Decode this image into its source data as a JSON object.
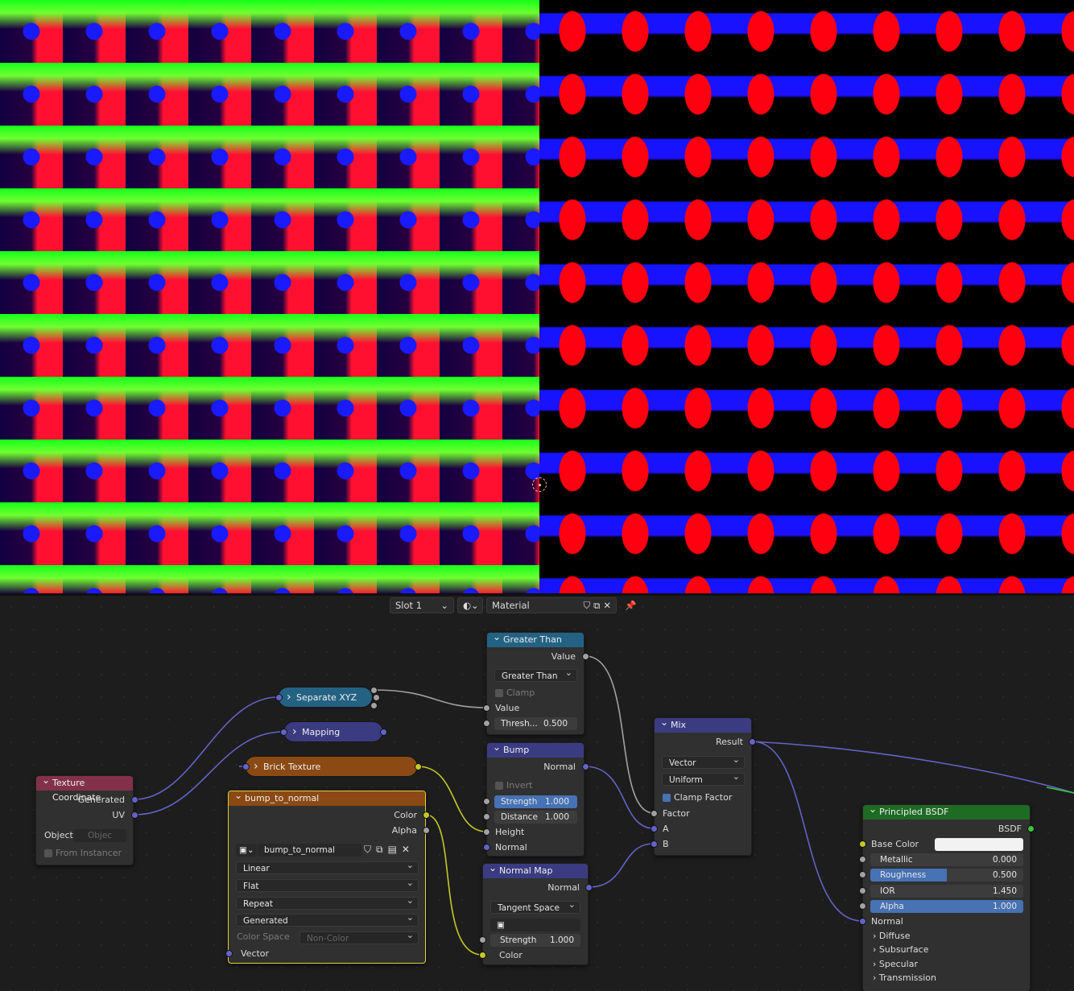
{
  "header": {
    "slot": "Slot 1",
    "material": "Material"
  },
  "nodes": {
    "greater_than": {
      "title": "Greater Than",
      "out_value": "Value",
      "operation": "Greater Than",
      "clamp": "Clamp",
      "in_value": "Value",
      "threshold_label": "Thresh...",
      "threshold": "0.500"
    },
    "separate_xyz": {
      "title": "Separate XYZ"
    },
    "mapping": {
      "title": "Mapping"
    },
    "brick": {
      "title": "Brick Texture"
    },
    "texcoord": {
      "title": "Texture Coordinate",
      "generated": "Generated",
      "uv": "UV",
      "object_label": "Object:",
      "object_placeholder": "Objec",
      "from_instancer": "From Instancer"
    },
    "image": {
      "title": "bump_to_normal",
      "color": "Color",
      "alpha": "Alpha",
      "image_name": "bump_to_normal",
      "interpolation": "Linear",
      "projection": "Flat",
      "extension": "Repeat",
      "source": "Generated",
      "colorspace_label": "Color Space",
      "colorspace": "Non-Color",
      "vector": "Vector"
    },
    "bump": {
      "title": "Bump",
      "normal_out": "Normal",
      "invert": "Invert",
      "strength_label": "Strength",
      "strength": "1.000",
      "distance_label": "Distance",
      "distance": "1.000",
      "height": "Height",
      "normal_in": "Normal"
    },
    "normal_map": {
      "title": "Normal Map",
      "normal_out": "Normal",
      "space": "Tangent Space",
      "strength_label": "Strength",
      "strength": "1.000",
      "color": "Color"
    },
    "mix": {
      "title": "Mix",
      "result": "Result",
      "data_type": "Vector",
      "factor_mode": "Uniform",
      "clamp_factor": "Clamp Factor",
      "factor": "Factor",
      "a": "A",
      "b": "B"
    },
    "bsdf": {
      "title": "Principled BSDF",
      "out": "BSDF",
      "base_color": "Base Color",
      "metallic_label": "Metallic",
      "metallic": "0.000",
      "roughness_label": "Roughness",
      "roughness": "0.500",
      "roughness_fraction": 0.5,
      "ior_label": "IOR",
      "ior": "1.450",
      "alpha_label": "Alpha",
      "alpha": "1.000",
      "alpha_fraction": 1.0,
      "normal": "Normal",
      "panels": [
        "Diffuse",
        "Subsurface",
        "Specular",
        "Transmission"
      ]
    }
  },
  "colors": {
    "math_header": "#246283",
    "shader_header": "#1e6b24",
    "vector_header": "#3b3b82",
    "input_header": "#83314a",
    "texture_header": "#8b4a14",
    "socket_float": "#a1a1a1",
    "socket_vector": "#6363c7",
    "socket_color": "#c7c729",
    "socket_shader": "#3ac73a",
    "accent": "#4772b3"
  }
}
